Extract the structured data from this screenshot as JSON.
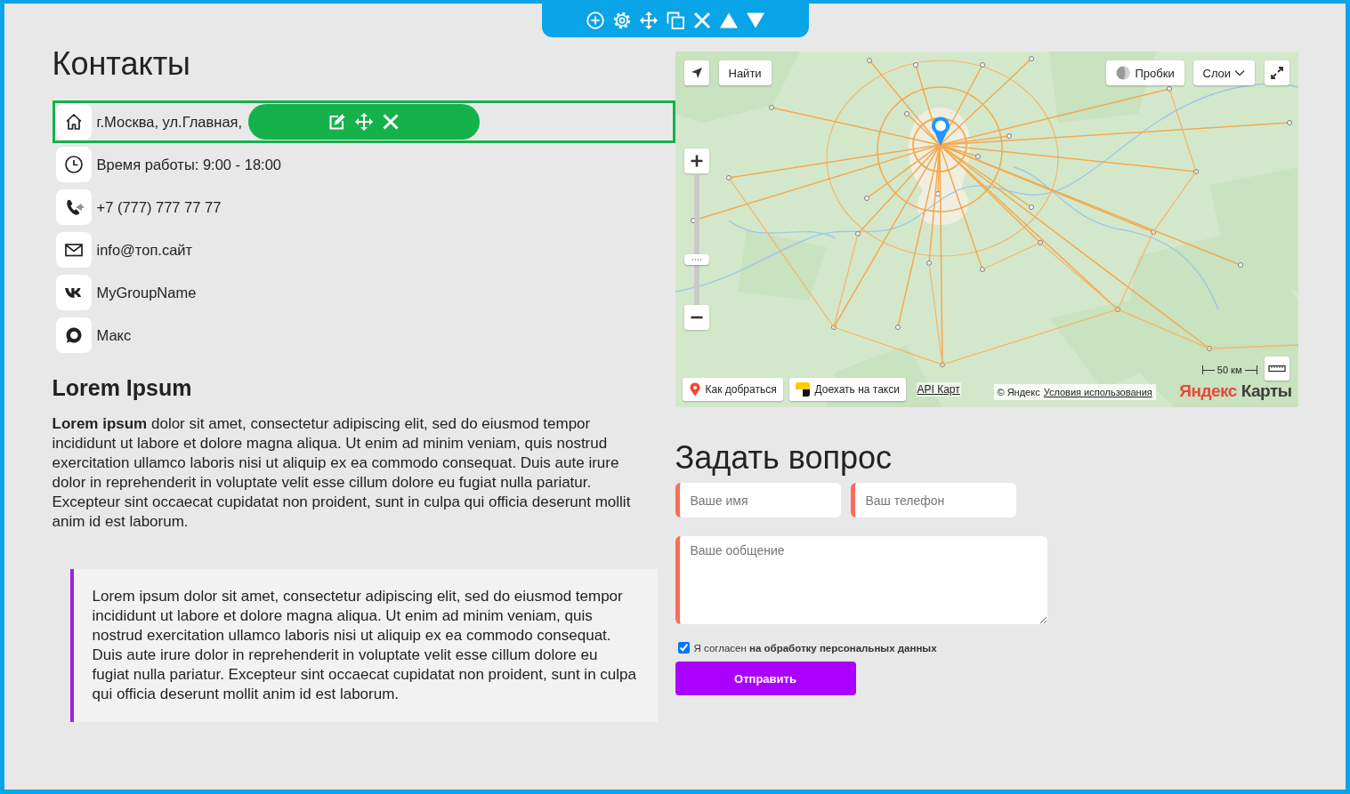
{
  "contacts": {
    "title": "Контакты",
    "items": [
      {
        "kind": "address",
        "text": "г.Москва, ул.Главная,",
        "selected": true
      },
      {
        "kind": "hours",
        "text": "Время работы: 9:00 - 18:00",
        "selected": false
      },
      {
        "kind": "phone",
        "text": "+7 (777) 777 77 77",
        "selected": false
      },
      {
        "kind": "email",
        "text": "info@топ.сайт",
        "selected": false
      },
      {
        "kind": "vk",
        "text": "MyGroupName",
        "selected": false
      },
      {
        "kind": "max",
        "text": "Макс",
        "selected": false
      }
    ]
  },
  "article": {
    "heading": "Lorem Ipsum",
    "paragraph": "**Lorem ipsum** dolor sit amet, consectetur adipiscing elit, sed do eiusmod tempor incididunt ut labore et dolore magna aliqua. Ut enim ad minim veniam, quis nostrud exercitation ullamco laboris nisi ut aliquip ex ea commodo consequat. Duis aute irure dolor in reprehenderit in voluptate velit esse cillum dolore eu fugiat nulla pariatur. Excepteur sint occaecat cupidatat non proident, sunt in culpa qui officia deserunt mollit anim id est laborum.",
    "quote": "Lorem ipsum dolor sit amet, consectetur adipiscing elit, sed do eiusmod tempor incididunt ut labore et dolore magna aliqua. Ut enim ad minim veniam, quis nostrud exercitation ullamco laboris nisi ut aliquip ex ea commodo consequat. Duis aute irure dolor in reprehenderit in voluptate velit esse cillum dolore eu fugiat nulla pariatur. Excepteur sint occaecat cupidatat non proident, sunt in culpa qui officia deserunt mollit anim id est laborum."
  },
  "map": {
    "search_button": "Найти",
    "traffic_button": "Пробки",
    "layers_button": "Слои",
    "zoom": {
      "level": 0.33
    },
    "route_button": "Как добраться",
    "taxi_button": "Доехать на такси",
    "api_link": "API Карт",
    "copyright": "© Яндекс",
    "terms_link": "Условия использования",
    "scale": "50 км",
    "logo": {
      "brand": "Яндекс",
      "product": "Карты"
    }
  },
  "question_form": {
    "title": "Задать вопрос",
    "fields": [
      {
        "placeholder": "Ваше имя"
      },
      {
        "placeholder": "Ваш телефон"
      }
    ],
    "message": {
      "placeholder": "Ваше ообщение"
    },
    "consent": {
      "checked": true,
      "label": "Я согласен **на обработку персональных данных**"
    },
    "submit": "Отправить"
  }
}
